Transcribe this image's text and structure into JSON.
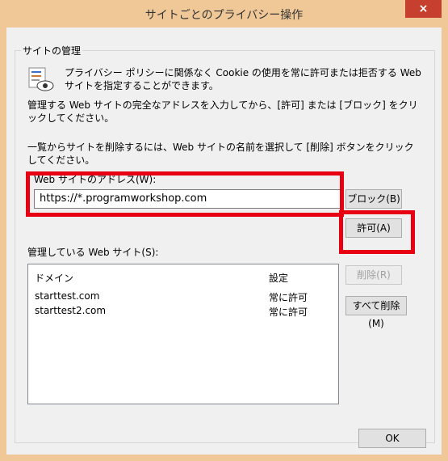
{
  "window": {
    "title": "サイトごとのプライバシー操作",
    "close_glyph": "×"
  },
  "group": {
    "label": "サイトの管理",
    "description": "プライバシー ポリシーに関係なく Cookie の使用を常に許可または拒否する Web サイトを指定することができます。",
    "instruction1": "管理する Web サイトの完全なアドレスを入力してから、[許可] または [ブロック] をクリックしてください。",
    "instruction2": "一覧からサイトを削除するには、Web サイトの名前を選択して [削除] ボタンをクリックしてください。"
  },
  "address": {
    "label": "Web サイトのアドレス(W):",
    "value": "https://*.programworkshop.com"
  },
  "buttons": {
    "block": "ブロック(B)",
    "allow": "許可(A)",
    "remove": "削除(R)",
    "remove_all": "すべて削除(M)",
    "ok": "OK"
  },
  "managed": {
    "label": "管理している Web サイト(S):",
    "col_domain": "ドメイン",
    "col_setting": "設定",
    "rows": [
      {
        "site": "starttest.com",
        "setting": "常に許可"
      },
      {
        "site": "starttest2.com",
        "setting": "常に許可"
      }
    ]
  }
}
